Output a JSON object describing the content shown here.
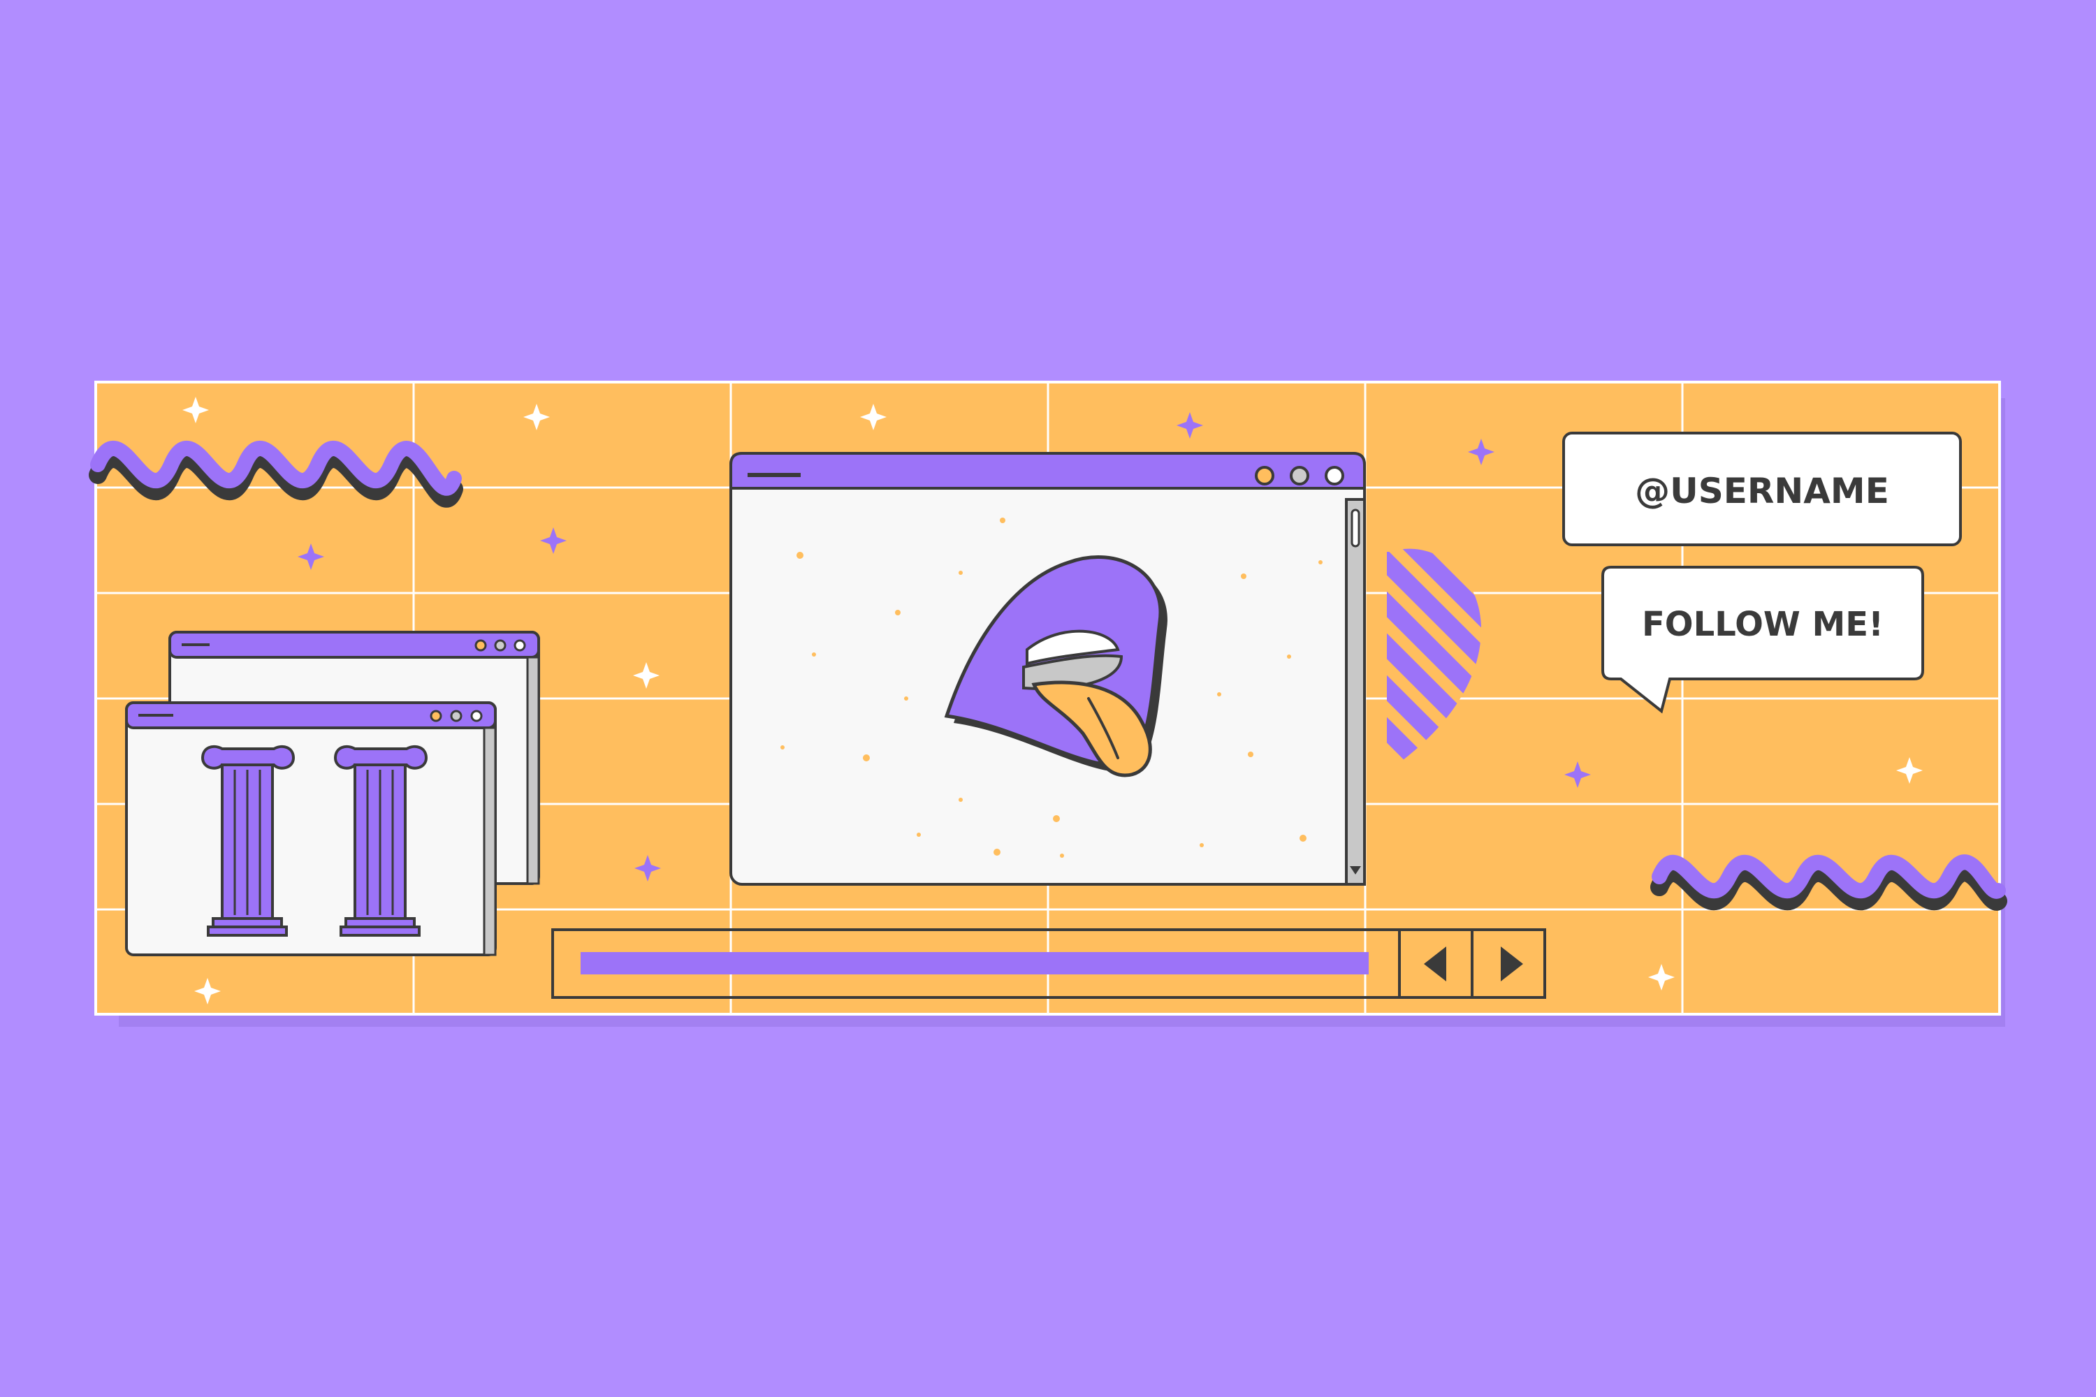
{
  "colors": {
    "background": "#b18dff",
    "banner": "#ffbe5e",
    "grid_line": "#ffffff",
    "purple": "#9c73f8",
    "outline": "#3a3a3a",
    "window_fill": "#f8f8f8",
    "scrollbar": "#c8c8c8",
    "sparkle_white": "#ffffff",
    "dot_orange": "#ffbe5e"
  },
  "social": {
    "username": "@USERNAME",
    "follow": "FOLLOW ME!"
  },
  "icons": {
    "lips": "lips-tongue-icon",
    "pillar": "ionic-column-icon",
    "prev": "triangle-left-icon",
    "next": "triangle-right-icon",
    "sparkle": "sparkle-icon",
    "wave": "zigzag-wave-icon",
    "stripes": "striped-heart-icon"
  },
  "media_bar": {
    "progress": 1.0
  }
}
